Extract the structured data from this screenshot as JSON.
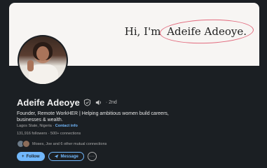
{
  "banner": {
    "greeting": "Hi, I'm",
    "highlight_name": "Adeife Adeoye."
  },
  "profile": {
    "name": "Adeife Adeoye",
    "degree": "· 2nd",
    "headline": "Founder, Remote WorkHER | Helping ambitious women build careers, businesses & wealth.",
    "location": "Lagos State, Nigeria",
    "contact_separator": " · ",
    "contact_label": "Contact info",
    "followers": "131,916 followers",
    "followers_separator": " · ",
    "connections": "500+ connections",
    "mutual": "Moses, Joe and 6 other mutual connections"
  },
  "actions": {
    "follow": "Follow",
    "message": "Message",
    "more": "···"
  },
  "colors": {
    "accent": "#71b7fb",
    "background": "#1b1f23",
    "ring": "#e26a7d"
  },
  "icons": [
    "verified-shield-icon",
    "speaker-icon",
    "plus-icon",
    "send-icon",
    "more-icon"
  ]
}
